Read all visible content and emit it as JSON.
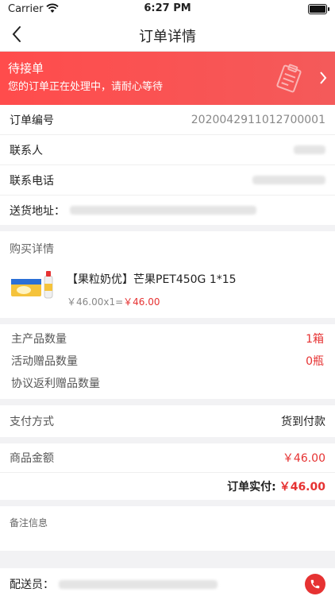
{
  "status_bar": {
    "carrier": "Carrier",
    "time": "6:27 PM"
  },
  "nav": {
    "title": "订单详情"
  },
  "banner": {
    "status": "待接单",
    "message": "您的订单正在处理中，请耐心等待"
  },
  "order": {
    "number_label": "订单编号",
    "number_value": "2020042911012700001",
    "contact_label": "联系人",
    "phone_label": "联系电话",
    "address_label": "送货地址："
  },
  "purchase": {
    "title": "购买详情",
    "product_name": "【果粒奶优】芒果PET450G 1*15",
    "price_expr": "￥46.00x1=",
    "price_total": "￥46.00"
  },
  "quantities": {
    "main_label": "主产品数量",
    "main_value": "1箱",
    "gift_label": "活动赠品数量",
    "gift_value": "0瓶",
    "rebate_label": "协议返利赠品数量"
  },
  "payment": {
    "label": "支付方式",
    "value": "货到付款"
  },
  "amount": {
    "goods_label": "商品金额",
    "goods_value": "￥46.00",
    "paid_label": "订单实付:",
    "paid_value": "￥46.00"
  },
  "remark": {
    "label": "备注信息"
  },
  "delivery": {
    "label": "配送员："
  },
  "colors": {
    "accent": "#e63232",
    "banner": "#ff4c4c"
  }
}
